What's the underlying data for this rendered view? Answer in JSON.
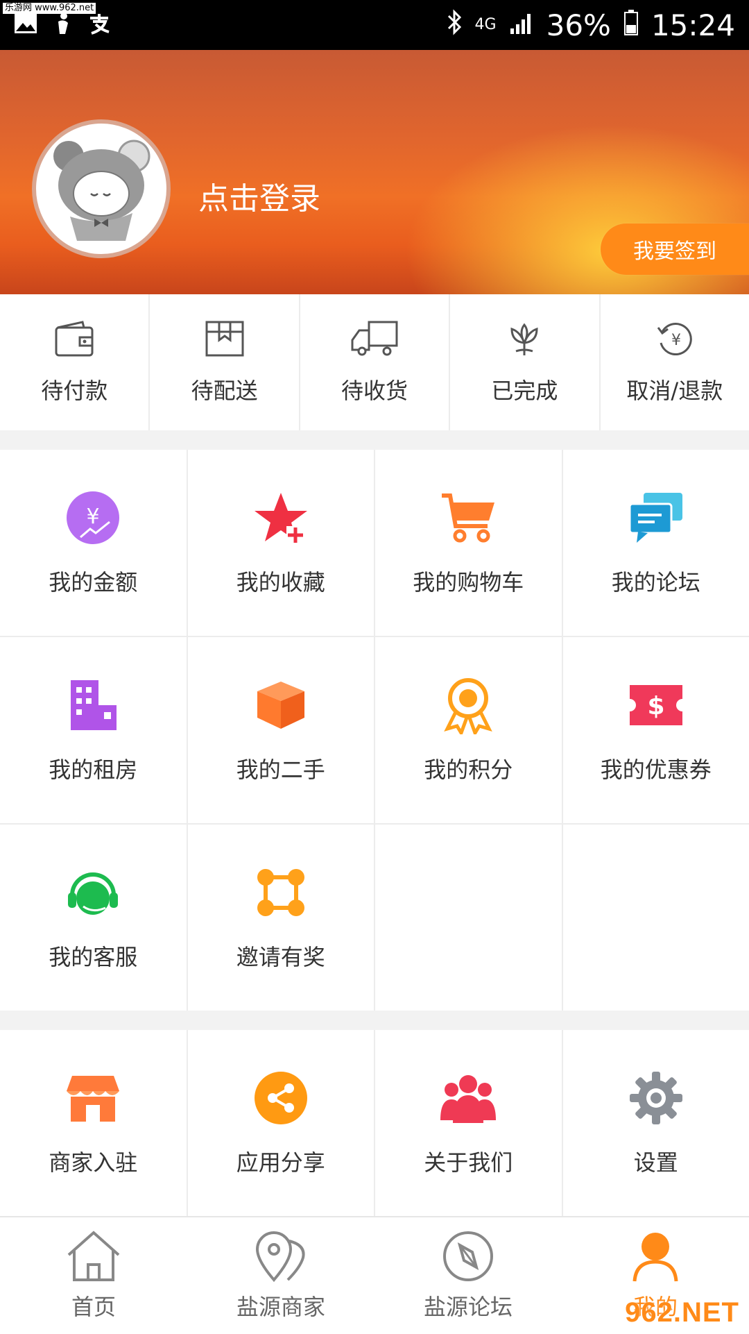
{
  "status_bar": {
    "network": "4G",
    "battery": "36%",
    "time": "15:24",
    "watermark": "乐游网 www.962.net",
    "left_icons": [
      "image-icon",
      "notification-icon",
      "alipay-icon"
    ]
  },
  "header": {
    "login_text": "点击登录",
    "signin_button": "我要签到"
  },
  "orders": [
    {
      "label": "待付款",
      "icon": "wallet-icon"
    },
    {
      "label": "待配送",
      "icon": "package-icon"
    },
    {
      "label": "待收货",
      "icon": "truck-icon"
    },
    {
      "label": "已完成",
      "icon": "flower-icon"
    },
    {
      "label": "取消/退款",
      "icon": "refund-icon"
    }
  ],
  "menu": [
    {
      "label": "我的金额",
      "icon": "money-icon"
    },
    {
      "label": "我的收藏",
      "icon": "star-plus-icon"
    },
    {
      "label": "我的购物车",
      "icon": "cart-icon"
    },
    {
      "label": "我的论坛",
      "icon": "chat-icon"
    },
    {
      "label": "我的租房",
      "icon": "building-icon"
    },
    {
      "label": "我的二手",
      "icon": "box-icon"
    },
    {
      "label": "我的积分",
      "icon": "medal-icon"
    },
    {
      "label": "我的优惠券",
      "icon": "coupon-icon"
    },
    {
      "label": "我的客服",
      "icon": "headset-icon"
    },
    {
      "label": "邀请有奖",
      "icon": "network-icon"
    }
  ],
  "more": [
    {
      "label": "商家入驻",
      "icon": "shop-icon"
    },
    {
      "label": "应用分享",
      "icon": "share-icon"
    },
    {
      "label": "关于我们",
      "icon": "users-icon"
    },
    {
      "label": "设置",
      "icon": "gear-icon"
    }
  ],
  "nav": [
    {
      "label": "首页",
      "icon": "home-icon"
    },
    {
      "label": "盐源商家",
      "icon": "map-pin-icon"
    },
    {
      "label": "盐源论坛",
      "icon": "compass-icon"
    },
    {
      "label": "我的",
      "icon": "user-icon"
    }
  ],
  "watermark_bottom": "962.NET",
  "colors": {
    "accent": "#ff8a18",
    "header_gradient": [
      "#c85a34",
      "#f07026",
      "#ffd23c"
    ]
  }
}
